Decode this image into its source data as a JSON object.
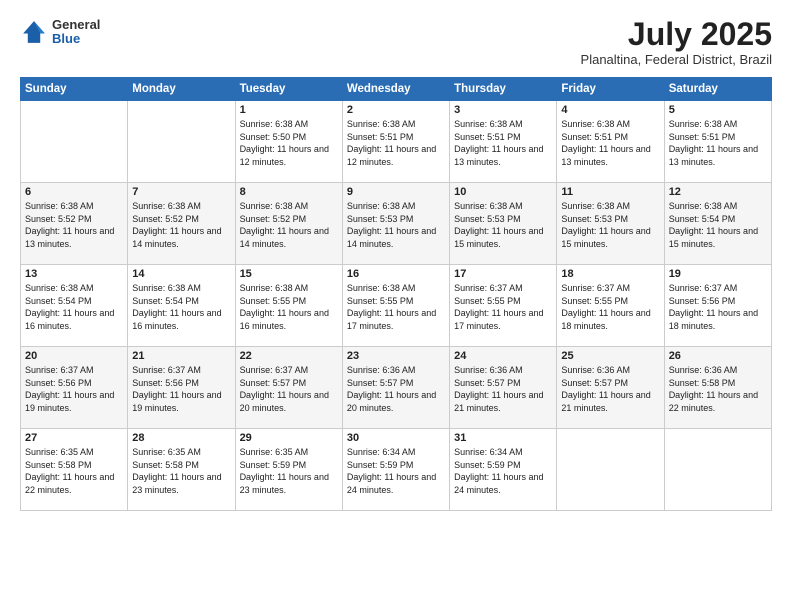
{
  "logo": {
    "general": "General",
    "blue": "Blue"
  },
  "header": {
    "month": "July 2025",
    "location": "Planaltina, Federal District, Brazil"
  },
  "weekdays": [
    "Sunday",
    "Monday",
    "Tuesday",
    "Wednesday",
    "Thursday",
    "Friday",
    "Saturday"
  ],
  "weeks": [
    [
      {
        "day": "",
        "content": ""
      },
      {
        "day": "",
        "content": ""
      },
      {
        "day": "1",
        "content": "Sunrise: 6:38 AM\nSunset: 5:50 PM\nDaylight: 11 hours and 12 minutes."
      },
      {
        "day": "2",
        "content": "Sunrise: 6:38 AM\nSunset: 5:51 PM\nDaylight: 11 hours and 12 minutes."
      },
      {
        "day": "3",
        "content": "Sunrise: 6:38 AM\nSunset: 5:51 PM\nDaylight: 11 hours and 13 minutes."
      },
      {
        "day": "4",
        "content": "Sunrise: 6:38 AM\nSunset: 5:51 PM\nDaylight: 11 hours and 13 minutes."
      },
      {
        "day": "5",
        "content": "Sunrise: 6:38 AM\nSunset: 5:51 PM\nDaylight: 11 hours and 13 minutes."
      }
    ],
    [
      {
        "day": "6",
        "content": "Sunrise: 6:38 AM\nSunset: 5:52 PM\nDaylight: 11 hours and 13 minutes."
      },
      {
        "day": "7",
        "content": "Sunrise: 6:38 AM\nSunset: 5:52 PM\nDaylight: 11 hours and 14 minutes."
      },
      {
        "day": "8",
        "content": "Sunrise: 6:38 AM\nSunset: 5:52 PM\nDaylight: 11 hours and 14 minutes."
      },
      {
        "day": "9",
        "content": "Sunrise: 6:38 AM\nSunset: 5:53 PM\nDaylight: 11 hours and 14 minutes."
      },
      {
        "day": "10",
        "content": "Sunrise: 6:38 AM\nSunset: 5:53 PM\nDaylight: 11 hours and 15 minutes."
      },
      {
        "day": "11",
        "content": "Sunrise: 6:38 AM\nSunset: 5:53 PM\nDaylight: 11 hours and 15 minutes."
      },
      {
        "day": "12",
        "content": "Sunrise: 6:38 AM\nSunset: 5:54 PM\nDaylight: 11 hours and 15 minutes."
      }
    ],
    [
      {
        "day": "13",
        "content": "Sunrise: 6:38 AM\nSunset: 5:54 PM\nDaylight: 11 hours and 16 minutes."
      },
      {
        "day": "14",
        "content": "Sunrise: 6:38 AM\nSunset: 5:54 PM\nDaylight: 11 hours and 16 minutes."
      },
      {
        "day": "15",
        "content": "Sunrise: 6:38 AM\nSunset: 5:55 PM\nDaylight: 11 hours and 16 minutes."
      },
      {
        "day": "16",
        "content": "Sunrise: 6:38 AM\nSunset: 5:55 PM\nDaylight: 11 hours and 17 minutes."
      },
      {
        "day": "17",
        "content": "Sunrise: 6:37 AM\nSunset: 5:55 PM\nDaylight: 11 hours and 17 minutes."
      },
      {
        "day": "18",
        "content": "Sunrise: 6:37 AM\nSunset: 5:55 PM\nDaylight: 11 hours and 18 minutes."
      },
      {
        "day": "19",
        "content": "Sunrise: 6:37 AM\nSunset: 5:56 PM\nDaylight: 11 hours and 18 minutes."
      }
    ],
    [
      {
        "day": "20",
        "content": "Sunrise: 6:37 AM\nSunset: 5:56 PM\nDaylight: 11 hours and 19 minutes."
      },
      {
        "day": "21",
        "content": "Sunrise: 6:37 AM\nSunset: 5:56 PM\nDaylight: 11 hours and 19 minutes."
      },
      {
        "day": "22",
        "content": "Sunrise: 6:37 AM\nSunset: 5:57 PM\nDaylight: 11 hours and 20 minutes."
      },
      {
        "day": "23",
        "content": "Sunrise: 6:36 AM\nSunset: 5:57 PM\nDaylight: 11 hours and 20 minutes."
      },
      {
        "day": "24",
        "content": "Sunrise: 6:36 AM\nSunset: 5:57 PM\nDaylight: 11 hours and 21 minutes."
      },
      {
        "day": "25",
        "content": "Sunrise: 6:36 AM\nSunset: 5:57 PM\nDaylight: 11 hours and 21 minutes."
      },
      {
        "day": "26",
        "content": "Sunrise: 6:36 AM\nSunset: 5:58 PM\nDaylight: 11 hours and 22 minutes."
      }
    ],
    [
      {
        "day": "27",
        "content": "Sunrise: 6:35 AM\nSunset: 5:58 PM\nDaylight: 11 hours and 22 minutes."
      },
      {
        "day": "28",
        "content": "Sunrise: 6:35 AM\nSunset: 5:58 PM\nDaylight: 11 hours and 23 minutes."
      },
      {
        "day": "29",
        "content": "Sunrise: 6:35 AM\nSunset: 5:59 PM\nDaylight: 11 hours and 23 minutes."
      },
      {
        "day": "30",
        "content": "Sunrise: 6:34 AM\nSunset: 5:59 PM\nDaylight: 11 hours and 24 minutes."
      },
      {
        "day": "31",
        "content": "Sunrise: 6:34 AM\nSunset: 5:59 PM\nDaylight: 11 hours and 24 minutes."
      },
      {
        "day": "",
        "content": ""
      },
      {
        "day": "",
        "content": ""
      }
    ]
  ]
}
